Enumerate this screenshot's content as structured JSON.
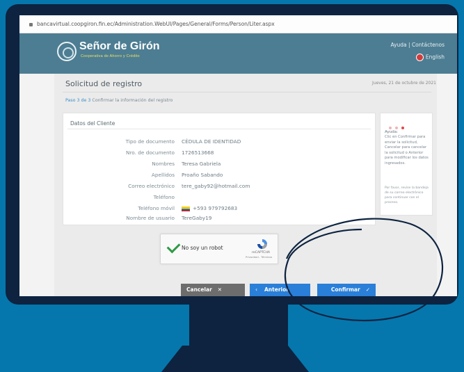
{
  "browser": {
    "address": "bancavirtual.coopgiron.fin.ec/Administration.WebUI/Pages/General/Forms/Person/Liter.aspx"
  },
  "site": {
    "logo_name": "Señor de Girón",
    "logo_subtitle": "Cooperativa de Ahorro y Crédito",
    "help_links": "Ayuda | Contáctenos",
    "language": "English"
  },
  "page": {
    "title": "Solicitud de registro",
    "date": "Jueves, 21 de octubre de 2021",
    "step": "Paso 3 de 3",
    "step_desc": "Confirmar la información del registro"
  },
  "client": {
    "section_title": "Datos del Cliente",
    "rows": [
      {
        "label": "Tipo de documento",
        "value": "CÉDULA DE IDENTIDAD"
      },
      {
        "label": "Nro. de documento",
        "value": "1726513668"
      },
      {
        "label": "Nombres",
        "value": "Teresa Gabriela"
      },
      {
        "label": "Apellidos",
        "value": "Proaño Sabando"
      },
      {
        "label": "Correo electrónico",
        "value": "tere_gaby92@hotmail.com"
      },
      {
        "label": "Teléfono",
        "value": ""
      },
      {
        "label": "Teléfono móvil",
        "value": "+593 979792683"
      },
      {
        "label": "Nombre de usuario",
        "value": "TereGaby19"
      }
    ]
  },
  "help": {
    "title": "Ayuda:",
    "body": "Clic en Confirmar para enviar la solicitud, Cancelar para cancelar la solicitud o Anterior para modificar los datos ingresados.",
    "foot": "Por favor, revise la bandeja de su correo electrónico para continuar con el proceso."
  },
  "captcha": {
    "label": "No soy un robot",
    "brand": "reCAPTCHA",
    "links": "Privacidad - Términos"
  },
  "buttons": {
    "cancel": "Cancelar",
    "previous": "Anterior",
    "confirm": "Confirmar"
  },
  "icons": {
    "cancel": "close-icon",
    "previous": "chevron-left-icon",
    "confirm": "check-icon"
  },
  "colors": {
    "header": "#4d7d92",
    "primary_button": "#2a7fd8",
    "cancel_button": "#6d6d6d",
    "monitor": "#0d2340",
    "background": "#0577ad"
  }
}
